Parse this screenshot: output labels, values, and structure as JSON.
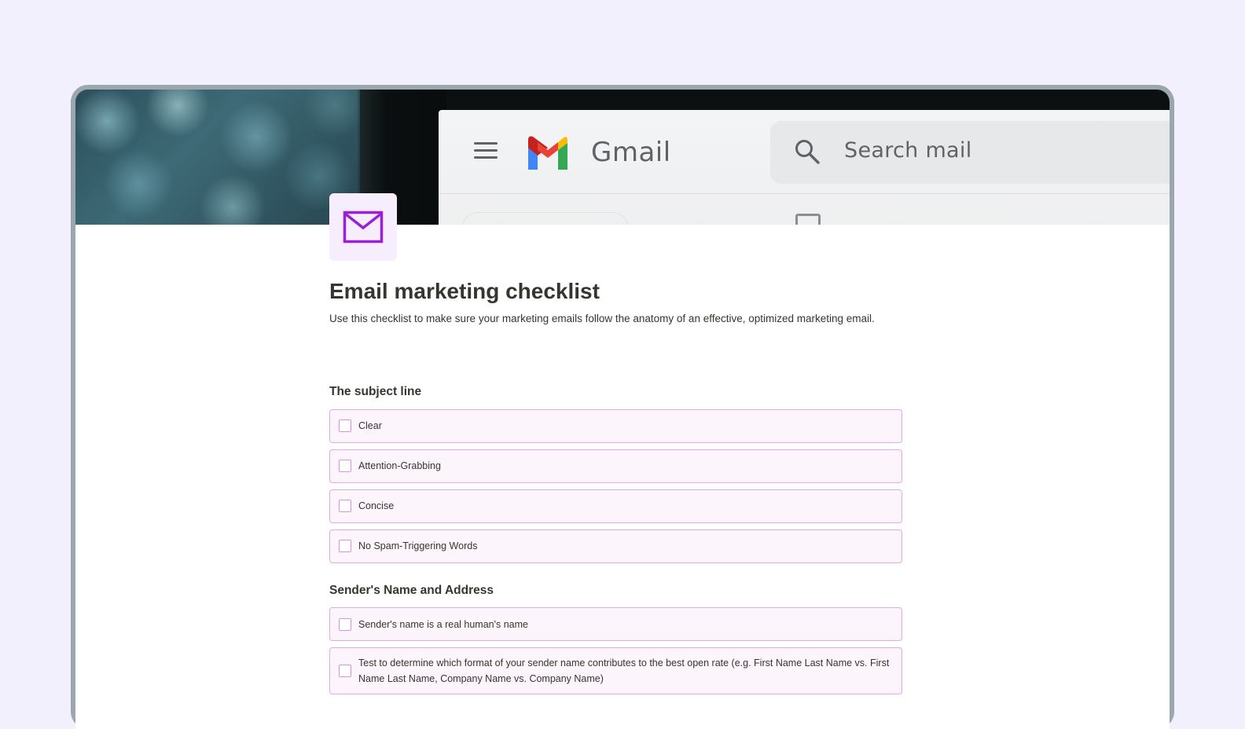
{
  "cover": {
    "gmail_wordmark": "Gmail",
    "search_placeholder": "Search mail",
    "icons": [
      "hamburger-menu-icon",
      "gmail-logo-icon",
      "search-icon"
    ]
  },
  "page": {
    "icon": "envelope-icon",
    "title": "Email marketing checklist",
    "description": "Use this checklist to make sure your marketing emails follow the anatomy of an effective, optimized marketing email."
  },
  "sections": [
    {
      "heading": "The subject line",
      "items": [
        {
          "label": "Clear",
          "checked": false
        },
        {
          "label": "Attention-Grabbing",
          "checked": false
        },
        {
          "label": "Concise",
          "checked": false
        },
        {
          "label": "No Spam-Triggering Words",
          "checked": false
        }
      ]
    },
    {
      "heading": "Sender's Name and Address",
      "items": [
        {
          "label": "Sender's name is a real human's name",
          "checked": false
        },
        {
          "label": "Test to determine which format of your sender name contributes to the best open rate (e.g. First Name Last Name vs. First Name Last Name, Company Name vs. Company Name)",
          "checked": false
        }
      ]
    }
  ],
  "colors": {
    "background": "#f2f0fd",
    "frame": "#9ba6ad",
    "item_fill": "#fcf5fc",
    "item_border": "#e3a8ea",
    "checkbox_border": "#dd8fe0",
    "icon_accent": "#9b1fd6",
    "text": "#37352f"
  }
}
